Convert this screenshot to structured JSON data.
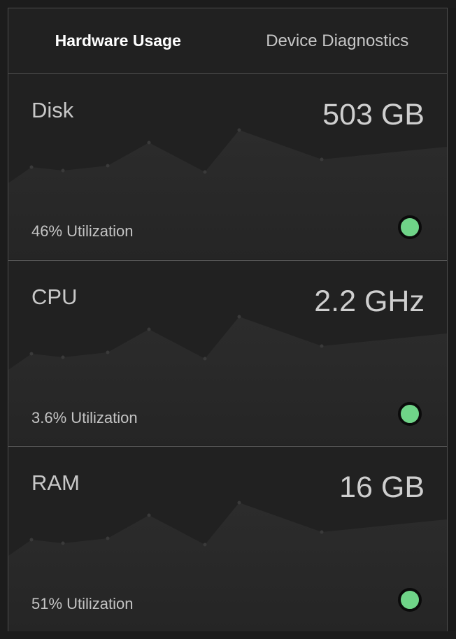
{
  "tabs": [
    {
      "label": "Hardware Usage",
      "active": true
    },
    {
      "label": "Device Diagnostics",
      "active": false
    }
  ],
  "cards": [
    {
      "name": "Disk",
      "value": "503 GB",
      "utilization": "46% Utilization",
      "status_color": "#6fd488"
    },
    {
      "name": "CPU",
      "value": "2.2 GHz",
      "utilization": "3.6% Utilization",
      "status_color": "#6fd488"
    },
    {
      "name": "RAM",
      "value": "16 GB",
      "utilization": "51% Utilization",
      "status_color": "#6fd488"
    }
  ],
  "colors": {
    "background": "#1c1c1c",
    "panel": "#212121",
    "sparkline_fill": "#2b2b2b",
    "sparkline_point": "#3a3a3a",
    "status_ok": "#6fd488"
  }
}
